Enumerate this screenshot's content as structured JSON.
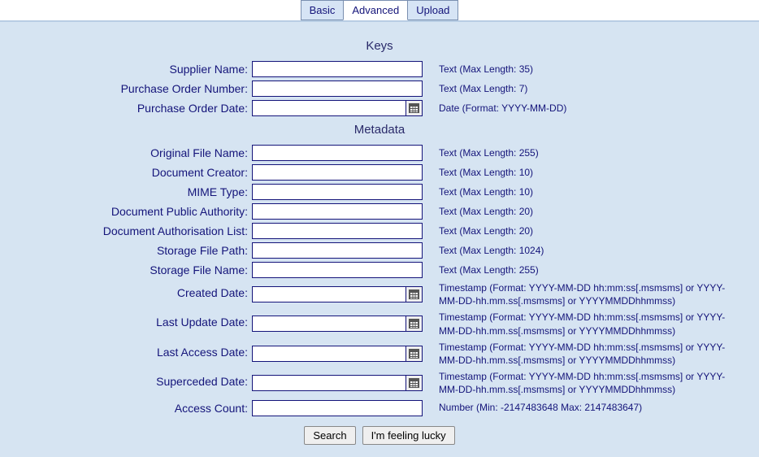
{
  "tabs": {
    "basic": "Basic",
    "advanced": "Advanced",
    "upload": "Upload",
    "active": "advanced"
  },
  "sections": {
    "keys": "Keys",
    "metadata": "Metadata"
  },
  "hints": {
    "text35": "Text (Max Length: 35)",
    "text7": "Text (Max Length: 7)",
    "date": "Date (Format: YYYY-MM-DD)",
    "text255": "Text (Max Length: 255)",
    "text10": "Text (Max Length: 10)",
    "text20": "Text (Max Length: 20)",
    "text1024": "Text (Max Length: 1024)",
    "timestamp": "Timestamp (Format: YYYY-MM-DD hh:mm:ss[.msmsms] or YYYY-MM-DD-hh.mm.ss[.msmsms] or YYYYMMDDhhmmss)",
    "number_int": "Number (Min: -2147483648 Max: 2147483647)"
  },
  "fields": {
    "supplier_name": {
      "label": "Supplier Name:",
      "value": "",
      "hint_key": "text35",
      "picker": false
    },
    "po_number": {
      "label": "Purchase Order Number:",
      "value": "",
      "hint_key": "text7",
      "picker": false
    },
    "po_date": {
      "label": "Purchase Order Date:",
      "value": "",
      "hint_key": "date",
      "picker": true
    },
    "orig_file_name": {
      "label": "Original File Name:",
      "value": "",
      "hint_key": "text255",
      "picker": false
    },
    "doc_creator": {
      "label": "Document Creator:",
      "value": "",
      "hint_key": "text10",
      "picker": false
    },
    "mime_type": {
      "label": "MIME Type:",
      "value": "",
      "hint_key": "text10",
      "picker": false
    },
    "doc_public_authority": {
      "label": "Document Public Authority:",
      "value": "",
      "hint_key": "text20",
      "picker": false
    },
    "doc_auth_list": {
      "label": "Document Authorisation List:",
      "value": "",
      "hint_key": "text20",
      "picker": false
    },
    "storage_file_path": {
      "label": "Storage File Path:",
      "value": "",
      "hint_key": "text1024",
      "picker": false
    },
    "storage_file_name": {
      "label": "Storage File Name:",
      "value": "",
      "hint_key": "text255",
      "picker": false
    },
    "created_date": {
      "label": "Created Date:",
      "value": "",
      "hint_key": "timestamp",
      "picker": true
    },
    "last_update_date": {
      "label": "Last Update Date:",
      "value": "",
      "hint_key": "timestamp",
      "picker": true
    },
    "last_access_date": {
      "label": "Last Access Date:",
      "value": "",
      "hint_key": "timestamp",
      "picker": true
    },
    "superceded_date": {
      "label": "Superceded Date:",
      "value": "",
      "hint_key": "timestamp",
      "picker": true
    },
    "access_count": {
      "label": "Access Count:",
      "value": "",
      "hint_key": "number_int",
      "picker": false
    }
  },
  "buttons": {
    "search": "Search",
    "lucky": "I'm feeling lucky"
  }
}
